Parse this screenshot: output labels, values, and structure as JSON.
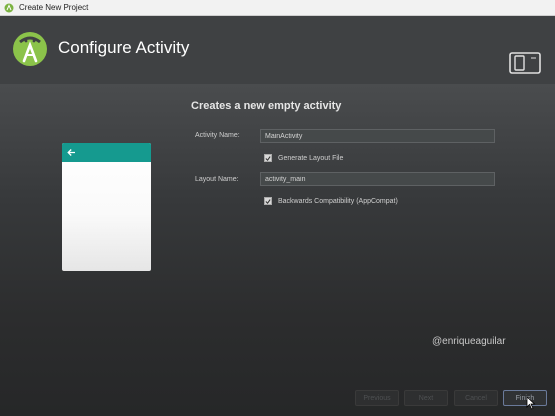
{
  "window": {
    "title": "Create New Project",
    "app_icon": "android-studio-icon"
  },
  "header": {
    "title": "Configure Activity",
    "logo": "android-studio-logo",
    "device_icon": "device-tablet-phone-icon"
  },
  "form": {
    "section_title": "Creates a new empty activity",
    "activity_name_label": "Activity Name:",
    "activity_name_value": "MainActivity",
    "generate_layout_label": "Generate Layout File",
    "generate_layout_checked": true,
    "layout_name_label": "Layout Name:",
    "layout_name_value": "activity_main",
    "backwards_compat_label": "Backwards Compatibility (AppCompat)",
    "backwards_compat_checked": true
  },
  "preview": {
    "back_icon": "arrow-left-icon",
    "appbar_color": "#159a8f"
  },
  "watermark": "@enriqueaguilar",
  "buttons": {
    "previous": "Previous",
    "next": "Next",
    "cancel": "Cancel",
    "finish": "Finish"
  },
  "colors": {
    "header_bg": "#3f4143",
    "accent": "#159a8f",
    "logo_green": "#8bc34a"
  }
}
